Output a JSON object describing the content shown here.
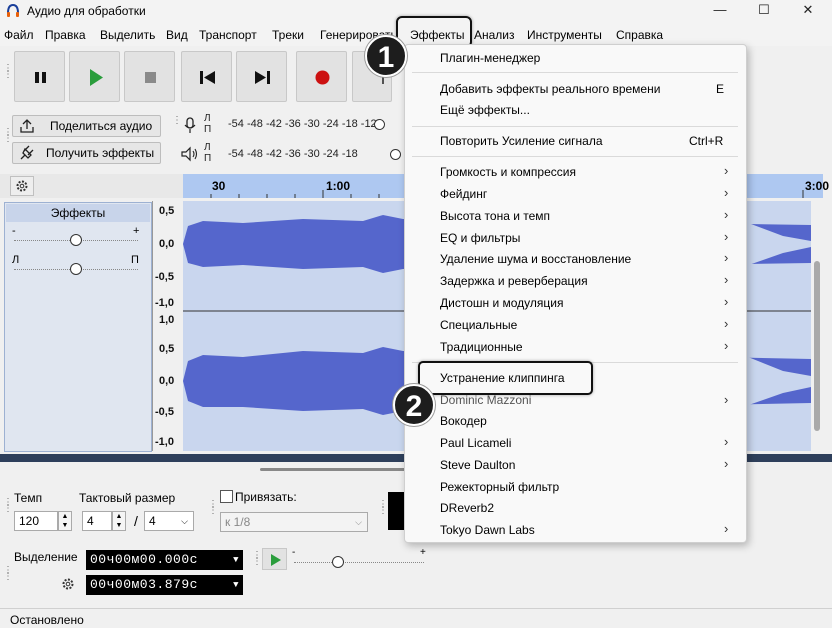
{
  "window": {
    "title": "Аудио для обработки",
    "minimize": "—",
    "maximize": "☐",
    "close": "✕"
  },
  "menubar": [
    "Файл",
    "Правка",
    "Выделить",
    "Вид",
    "Транспорт",
    "Треки",
    "Генерировать",
    "Эффекты",
    "Анализ",
    "Инструменты",
    "Справка"
  ],
  "toolbar": {
    "share_audio": "Поделиться аудио",
    "get_effects": "Получить эффекты",
    "meter_ticks": [
      "-54",
      "-48",
      "-42",
      "-36",
      "-30",
      "-24",
      "-18",
      "-12"
    ],
    "meter_ticks_play": [
      "-54",
      "-48",
      "-42",
      "-36",
      "-30",
      "-24",
      "-18"
    ],
    "lp": [
      "Л",
      "П"
    ]
  },
  "ruler": {
    "ticks": [
      "30",
      "1:00",
      "3:00"
    ]
  },
  "track": {
    "name": "Эффекты",
    "gain_minus": "-",
    "gain_plus": "+",
    "pan_left": "Л",
    "pan_right": "П",
    "amplitude_top": [
      "0,5",
      "0,0",
      "-0,5",
      "-1,0"
    ],
    "amplitude_bottom": [
      "1,0",
      "0,5",
      "0,0",
      "-0,5",
      "-1,0"
    ]
  },
  "effects_menu": {
    "items": [
      {
        "label": "Плагин-менеджер",
        "shortcut": "",
        "submenu": false
      },
      {
        "label": "Добавить эффекты реального времени",
        "shortcut": "E",
        "submenu": false
      },
      {
        "label": "Ещё эффекты...",
        "shortcut": "",
        "submenu": false
      },
      {
        "label": "Повторить Усиление сигнала",
        "shortcut": "Ctrl+R",
        "submenu": false
      },
      {
        "label": "Громкость и компрессия",
        "shortcut": "",
        "submenu": true
      },
      {
        "label": "Фейдинг",
        "shortcut": "",
        "submenu": true
      },
      {
        "label": "Высота тона и темп",
        "shortcut": "",
        "submenu": true
      },
      {
        "label": "EQ и фильтры",
        "shortcut": "",
        "submenu": true
      },
      {
        "label": "Удаление шума и восстановление",
        "shortcut": "",
        "submenu": true
      },
      {
        "label": "Задержка и реверберация",
        "shortcut": "",
        "submenu": true
      },
      {
        "label": "Дистошн и модуляция",
        "shortcut": "",
        "submenu": true
      },
      {
        "label": "Специальные",
        "shortcut": "",
        "submenu": true
      },
      {
        "label": "Традиционные",
        "shortcut": "",
        "submenu": true
      },
      {
        "label": "Устранение клиппинга",
        "shortcut": "",
        "submenu": false
      },
      {
        "label": "Dominic Mazzoni",
        "shortcut": "",
        "submenu": true
      },
      {
        "label": "Вокодер",
        "shortcut": "",
        "submenu": false
      },
      {
        "label": "Paul Licameli",
        "shortcut": "",
        "submenu": true
      },
      {
        "label": "Steve Daulton",
        "shortcut": "",
        "submenu": true
      },
      {
        "label": "Режекторный фильтр",
        "shortcut": "",
        "submenu": false
      },
      {
        "label": "DReverb2",
        "shortcut": "",
        "submenu": false
      },
      {
        "label": "Tokyo Dawn Labs",
        "shortcut": "",
        "submenu": true
      }
    ],
    "arrow": "›"
  },
  "annotations": {
    "step1": "1",
    "step2": "2"
  },
  "bottom": {
    "tempo_label": "Темп",
    "tempo_value": "120",
    "time_sig_label": "Тактовый размер",
    "time_sig_num": "4",
    "time_sig_slash": "/",
    "time_sig_den": "4",
    "snap_label": "Привязать:",
    "snap_value": "к 1/8",
    "selection_label": "Выделение",
    "sel_start": "00ч00м00.000с",
    "sel_end": "00ч00м03.879с",
    "speed_minus": "-",
    "speed_plus": "+"
  },
  "status": "Остановлено",
  "colors": {
    "waveform": "#5566cc",
    "track_bg": "#c9d6ee",
    "ruler": "#aec8f1",
    "record": "#cc1111",
    "play": "#2a9d3c"
  }
}
